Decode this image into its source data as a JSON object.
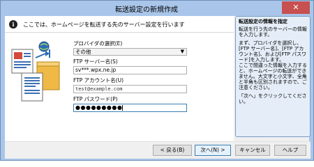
{
  "window": {
    "title": "転送設定の新規作成",
    "close_label": "✕"
  },
  "header": {
    "info_glyph": "i",
    "text": "ここでは、ホームページを転送する先のサーバー設定を行います"
  },
  "form": {
    "provider": {
      "label": "プロバイダの選択(E)",
      "selected": "その他"
    },
    "ftp_server": {
      "label": "FTP サーバー名(S)",
      "value": "sv***.wpx.ne.jp"
    },
    "ftp_account": {
      "label": "FTP アカウント名(U)",
      "value": "test@example.com"
    },
    "ftp_password": {
      "label": "FTP パスワード(P)",
      "value": "●●●●●●●●●"
    }
  },
  "help": {
    "title": "転送設定の情報を指定",
    "para1": "転送を行う先のサーバーの情報を入力します。",
    "para2": "まず、プロバイダを選択し、[FTP サーバー名]、[FTP アカウント名]、および[FTP パスワード]を入力します。\nここで間違った情報を入力すると、ホームページの転送ができません。大文字と小文字、全角と半角も区別されますので、ご注意ください。",
    "para3": "「次へ」をクリックしてください。"
  },
  "buttons": {
    "back": "< 戻る(B)",
    "next": "次へ(N) >",
    "cancel": "キャンセル",
    "help": "ヘルプ"
  },
  "colors": {
    "titlebar": "#a9c6ea",
    "close": "#c75050",
    "help_panel_bg": "#e5eef8",
    "focus_border": "#3c7fb1"
  }
}
